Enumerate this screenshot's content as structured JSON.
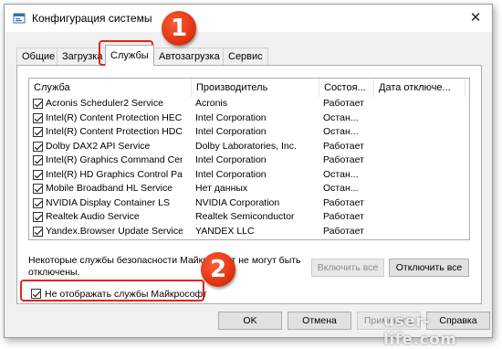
{
  "window": {
    "title": "Конфигурация системы",
    "close_glyph": "✕"
  },
  "tabs": [
    {
      "label": "Общие",
      "active": false
    },
    {
      "label": "Загрузка",
      "active": false
    },
    {
      "label": "Службы",
      "active": true
    },
    {
      "label": "Автозагрузка",
      "active": false
    },
    {
      "label": "Сервис",
      "active": false
    }
  ],
  "services": {
    "headers": {
      "name": "Служба",
      "manufacturer": "Производитель",
      "status": "Состоя...",
      "disabled_date": "Дата отключе..."
    },
    "rows": [
      {
        "checked": true,
        "name": "Acronis Scheduler2 Service",
        "manufacturer": "Acronis",
        "status": "Работает",
        "date": ""
      },
      {
        "checked": true,
        "name": "Intel(R) Content Protection HEC...",
        "manufacturer": "Intel Corporation",
        "status": "Остан...",
        "date": ""
      },
      {
        "checked": true,
        "name": "Intel(R) Content Protection HDC...",
        "manufacturer": "Intel Corporation",
        "status": "Остан...",
        "date": ""
      },
      {
        "checked": true,
        "name": "Dolby DAX2 API Service",
        "manufacturer": "Dolby Laboratories, Inc.",
        "status": "Работает",
        "date": ""
      },
      {
        "checked": true,
        "name": "Intel(R) Graphics Command Cen...",
        "manufacturer": "Intel Corporation",
        "status": "Работает",
        "date": ""
      },
      {
        "checked": true,
        "name": "Intel(R) HD Graphics Control Pa...",
        "manufacturer": "Intel Corporation",
        "status": "Остан...",
        "date": ""
      },
      {
        "checked": true,
        "name": "Mobile Broadband HL Service",
        "manufacturer": "Нет данных",
        "status": "Остан...",
        "date": ""
      },
      {
        "checked": true,
        "name": "NVIDIA Display Container LS",
        "manufacturer": "NVIDIA Corporation",
        "status": "Работает",
        "date": ""
      },
      {
        "checked": true,
        "name": "Realtek Audio Service",
        "manufacturer": "Realtek Semiconductor",
        "status": "Работает",
        "date": ""
      },
      {
        "checked": true,
        "name": "Yandex.Browser Update Service",
        "manufacturer": "YANDEX LLC",
        "status": "Работает",
        "date": ""
      }
    ]
  },
  "note": "Некоторые службы безопасности Майкрософт не могут быть отключены.",
  "buttons": {
    "enable_all": "Включить все",
    "disable_all": "Отключить все",
    "ok": "OK",
    "cancel": "Отмена",
    "apply": "Применить",
    "help": "Справка"
  },
  "hide_microsoft": {
    "label": "Не отображать службы Майкрософт",
    "checked": true
  },
  "annotations": {
    "step1": "1",
    "step2": "2",
    "highlight_color": "#e5211b"
  },
  "watermark": "user-life.com"
}
